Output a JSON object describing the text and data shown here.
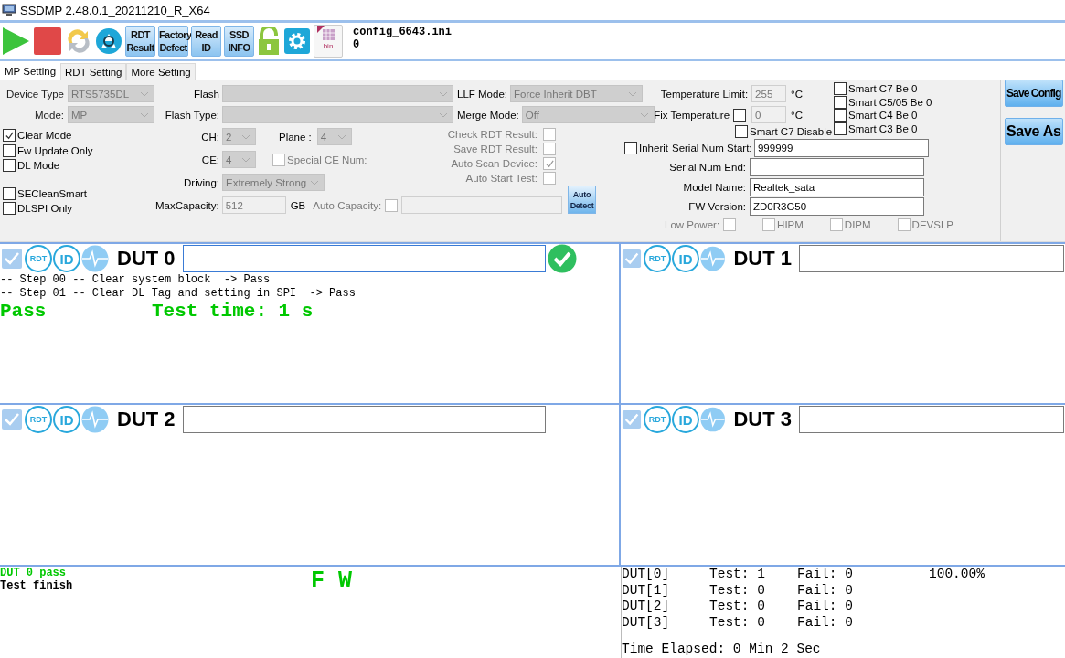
{
  "window": {
    "title": "SSDMP 2.48.0.1_20211210_R_X64"
  },
  "toolbar": {
    "buttons": [
      {
        "kind": "play"
      },
      {
        "kind": "stop"
      },
      {
        "kind": "refresh"
      },
      {
        "kind": "recycle"
      },
      {
        "kind": "text",
        "label": "RDT\nResult"
      },
      {
        "kind": "text",
        "label": "Factory\nDefect"
      },
      {
        "kind": "text",
        "label": "Read\nID"
      },
      {
        "kind": "text",
        "label": "SSD\nINFO"
      },
      {
        "kind": "lock"
      },
      {
        "kind": "gear"
      },
      {
        "kind": "bin",
        "label": "bin"
      }
    ],
    "config_file": "config_6643.ini",
    "config_value": "0"
  },
  "tabs": [
    {
      "label": "MP Setting",
      "selected": true
    },
    {
      "label": "RDT Setting",
      "selected": false
    },
    {
      "label": "More Setting",
      "selected": false
    }
  ],
  "settings": {
    "device_type": {
      "label": "Device Type",
      "value": "RTS5735DL"
    },
    "mode": {
      "label": "Mode:",
      "value": "MP"
    },
    "left_checks": [
      {
        "label": "Clear Mode",
        "checked": true
      },
      {
        "label": "Fw Update Only",
        "checked": false
      },
      {
        "label": "DL Mode",
        "checked": false
      }
    ],
    "lower_checks": [
      {
        "label": "SECleanSmart",
        "checked": false
      },
      {
        "label": "DLSPI Only",
        "checked": false
      }
    ],
    "flash": {
      "label": "Flash"
    },
    "flash_type": {
      "label": "Flash Type:"
    },
    "ch": {
      "label": "CH:",
      "value": "2"
    },
    "plane": {
      "label": "Plane :",
      "value": "4"
    },
    "ce": {
      "label": "CE:",
      "value": "4"
    },
    "special_ce": {
      "label": "Special CE Num:",
      "checked": false
    },
    "driving": {
      "label": "Driving:",
      "value": "Extremely Strong"
    },
    "max_capacity": {
      "label": "MaxCapacity:",
      "value": "512",
      "unit": "GB"
    },
    "auto_capacity": {
      "label": "Auto Capacity:",
      "checked": false
    },
    "llf_mode": {
      "label": "LLF Mode:",
      "value": "Force Inherit DBT"
    },
    "merge_mode": {
      "label": "Merge Mode:",
      "value": "Off"
    },
    "rdt_checks": [
      {
        "label": "Check RDT Result:",
        "checked": false
      },
      {
        "label": "Save RDT Result:",
        "checked": false
      },
      {
        "label": "Auto Scan Device:",
        "checked": true
      },
      {
        "label": "Auto Start Test:",
        "checked": false
      }
    ],
    "auto_detect": "Auto\nDetect",
    "temperature_limit": {
      "label": "Temperature Limit:",
      "value": "255",
      "unit": "°C"
    },
    "fix_temperature": {
      "label": "Fix Temperature",
      "checked": false,
      "value": "0",
      "unit": "°C"
    },
    "smart_c7_disable": {
      "label": "Smart C7 Disable",
      "checked": false
    },
    "smart_checks": [
      {
        "label": "Smart C7 Be 0",
        "checked": false
      },
      {
        "label": "Smart C5/05 Be 0",
        "checked": false
      },
      {
        "label": "Smart C4 Be 0",
        "checked": false
      },
      {
        "label": "Smart C3 Be 0",
        "checked": false
      }
    ],
    "inherit": {
      "label": "Inherit",
      "checked": false
    },
    "serial_fields": [
      {
        "label": "Serial Num Start:",
        "value": "999999"
      },
      {
        "label": "Serial Num End:"
      },
      {
        "label": "Model Name:",
        "value": "Realtek_sata"
      },
      {
        "label": "FW Version:",
        "value": "ZD0R3G50"
      }
    ],
    "low_power": {
      "label": "Low Power:",
      "checked": false
    },
    "power_modes": [
      {
        "label": "HIPM",
        "checked": false
      },
      {
        "label": "DIPM",
        "checked": false
      },
      {
        "label": "DEVSLP",
        "checked": false
      }
    ],
    "save_buttons": [
      "Save Config",
      "Save As"
    ]
  },
  "duts": [
    {
      "label": "DUT 0",
      "checked": true,
      "rdt": "RDT",
      "id": "ID",
      "passed": true,
      "log": [
        "-- Step 00 -- Clear system block  -> Pass",
        "-- Step 01 -- Clear DL Tag and setting in SPI  -> Pass"
      ],
      "result": "Pass",
      "test_time": "Test time: 1 s"
    },
    {
      "label": "DUT 1",
      "checked": true,
      "rdt": "RDT",
      "id": "ID",
      "passed": false
    },
    {
      "label": "DUT 2",
      "checked": true,
      "rdt": "RDT",
      "id": "ID",
      "passed": false
    },
    {
      "label": "DUT 3",
      "checked": true,
      "rdt": "RDT",
      "id": "ID",
      "passed": false
    }
  ],
  "message_log": {
    "lines": [
      {
        "text": "DUT 0 pass",
        "color": "#00c800"
      },
      {
        "text": "Test finish",
        "color": "#000000"
      }
    ],
    "banner": "F W"
  },
  "stats": {
    "rows": [
      {
        "dut": "DUT[0]",
        "test": "Test: 1",
        "fail": "Fail: 0",
        "yield": "100.00%"
      },
      {
        "dut": "DUT[1]",
        "test": "Test: 0",
        "fail": "Fail: 0"
      },
      {
        "dut": "DUT[2]",
        "test": "Test: 0",
        "fail": "Fail: 0"
      },
      {
        "dut": "DUT[3]",
        "test": "Test: 0",
        "fail": "Fail: 0"
      }
    ],
    "elapsed": "Time Elapsed: 0 Min 2 Sec"
  }
}
